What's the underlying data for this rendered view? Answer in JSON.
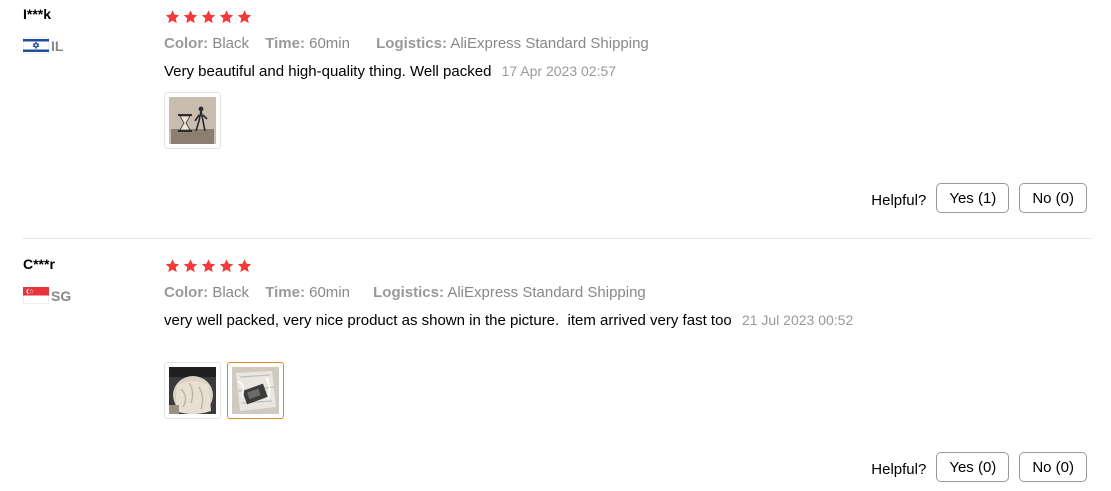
{
  "colors": {
    "star": "#f23a3a",
    "meta_text": "#888888",
    "selected_thumb_border": "#d98a2a"
  },
  "helpful_label": "Helpful?",
  "reviews": [
    {
      "user": "I***k",
      "country_code": "IL",
      "flag": "israel-flag",
      "rating": 5,
      "color_label": "Color:",
      "color_value": "Black",
      "time_label": "Time:",
      "time_value": "60min",
      "logistics_label": "Logistics:",
      "logistics_value": "AliExpress Standard Shipping",
      "text": "Very beautiful and high-quality thing. Well packed",
      "date": "17 Apr 2023 02:57",
      "photos": [
        "hourglass-photo"
      ],
      "yes_label": "Yes (1)",
      "no_label": "No (0)"
    },
    {
      "user": "C***r",
      "country_code": "SG",
      "flag": "singapore-flag",
      "rating": 5,
      "color_label": "Color:",
      "color_value": "Black",
      "time_label": "Time:",
      "time_value": "60min",
      "logistics_label": "Logistics:",
      "logistics_value": "AliExpress Standard Shipping",
      "text": "very well packed, very nice product as shown in the picture.  item arrived very fast too",
      "date": "21 Jul 2023 00:52",
      "photos": [
        "packaging-photo",
        "wrapped-product-photo"
      ],
      "yes_label": "Yes (0)",
      "no_label": "No (0)"
    }
  ]
}
